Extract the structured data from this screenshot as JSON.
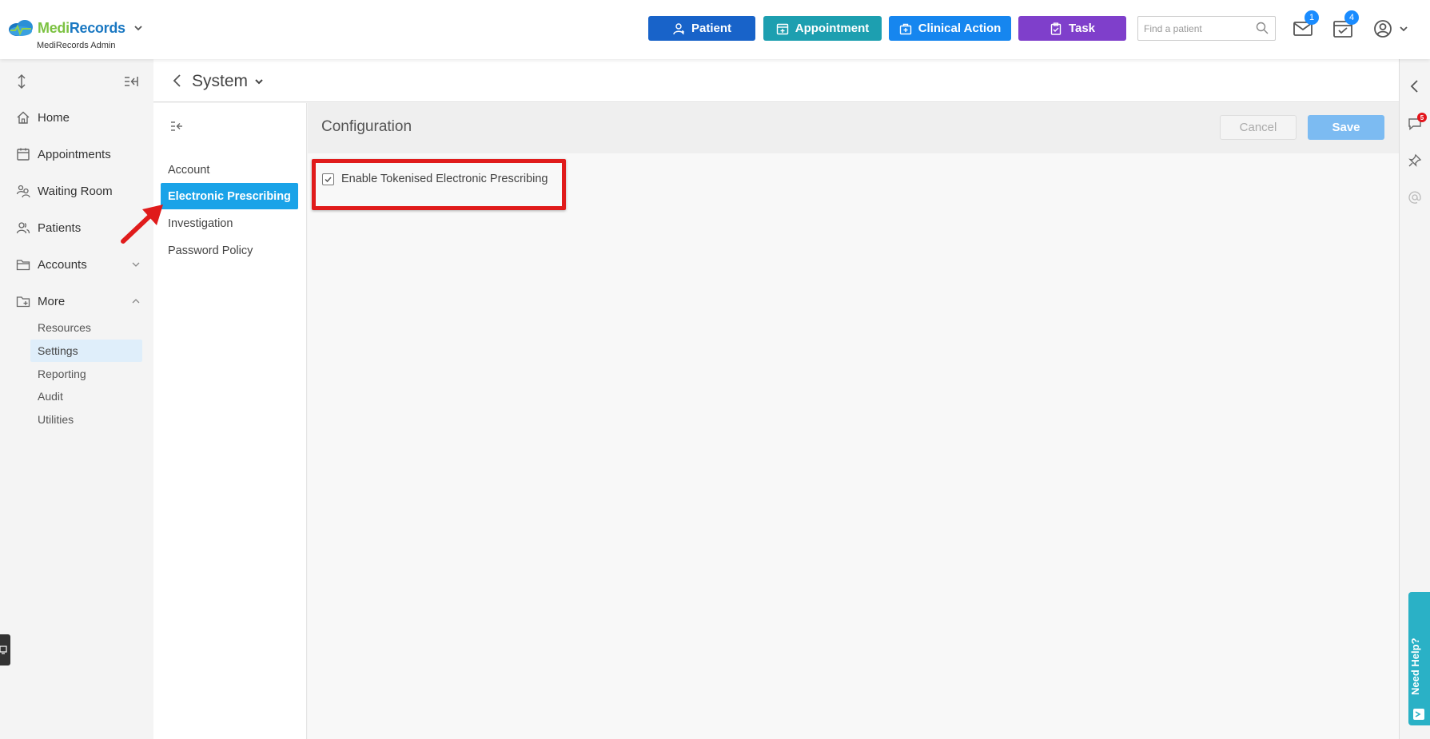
{
  "app": {
    "brand_part1": "Medi",
    "brand_part2": "Records",
    "subtitle": "MediRecords Admin"
  },
  "toolbar": {
    "patient_label": "Patient",
    "appointment_label": "Appointment",
    "clinical_action_label": "Clinical Action",
    "task_label": "Task",
    "search_placeholder": "Find a patient",
    "mail_badge": "1",
    "calendar_badge": "4"
  },
  "sidebar": {
    "items": [
      {
        "label": "Home",
        "icon": "home-icon"
      },
      {
        "label": "Appointments",
        "icon": "calendar-icon"
      },
      {
        "label": "Waiting Room",
        "icon": "waiting-room-icon"
      },
      {
        "label": "Patients",
        "icon": "patients-icon"
      },
      {
        "label": "Accounts",
        "icon": "folder-icon"
      },
      {
        "label": "More",
        "icon": "folder-plus-icon"
      }
    ],
    "more_items": [
      {
        "label": "Resources",
        "active": false
      },
      {
        "label": "Settings",
        "active": true
      },
      {
        "label": "Reporting",
        "active": false
      },
      {
        "label": "Audit",
        "active": false
      },
      {
        "label": "Utilities",
        "active": false
      }
    ]
  },
  "page": {
    "title": "System"
  },
  "subnav": {
    "items": [
      {
        "label": "Account",
        "active": false
      },
      {
        "label": "Electronic Prescribing",
        "active": true
      },
      {
        "label": "Investigation",
        "active": false
      },
      {
        "label": "Password Policy",
        "active": false
      }
    ]
  },
  "config": {
    "title": "Configuration",
    "cancel_label": "Cancel",
    "save_label": "Save",
    "checkbox_label": "Enable Tokenised Electronic Prescribing",
    "checkbox_checked": true
  },
  "rightrail": {
    "chat_badge": "5",
    "need_help_label": "Need Help?"
  },
  "colors": {
    "patient_button": "#1863c9",
    "appointment_button": "#1d9fb0",
    "clinical_action_button": "#1686ef",
    "task_button": "#7f3fcb",
    "active_subnav": "#1aa3e8",
    "save_button": "#7cbbf2",
    "highlight": "#e01b1b"
  }
}
